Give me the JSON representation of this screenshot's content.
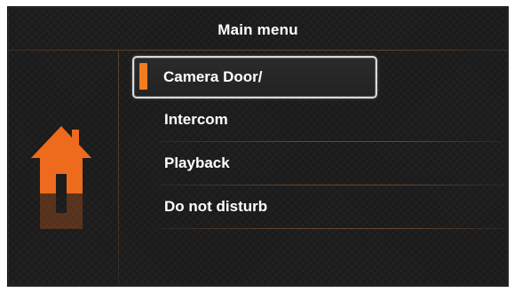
{
  "header": {
    "title": "Main menu"
  },
  "sidebar": {
    "icon": "home-icon",
    "icon_color": "#ee6a1c"
  },
  "menu": {
    "items": [
      {
        "label": "Camera Door/",
        "selected": true
      },
      {
        "label": "Intercom",
        "selected": false
      },
      {
        "label": "Playback",
        "selected": false
      },
      {
        "label": "Do not disturb",
        "selected": false
      }
    ]
  },
  "colors": {
    "background": "#1b1b1b",
    "accent": "#f07d1f",
    "text": "#ffffff",
    "divider": "#a0693f"
  }
}
